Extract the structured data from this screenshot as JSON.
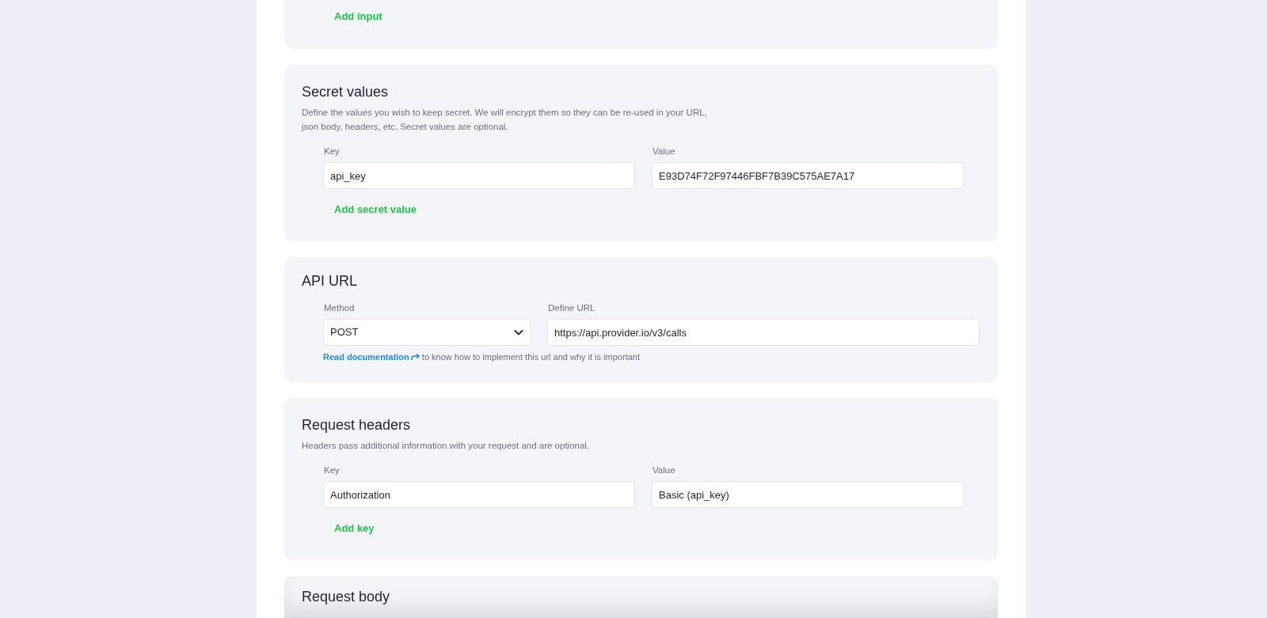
{
  "sections": [
    {
      "kind": "inputs",
      "add_link": "Add input"
    },
    {
      "kind": "key_value",
      "title": "Secret values",
      "description": "Define the values you wish to keep secret. We will encrypt them so they can be re-used in your URL, json body, headers, etc. Secret values are optional.",
      "pairs": [
        {
          "key_label": "Key",
          "key": "api_key",
          "value_label": "Value",
          "value": "E93D74F72F97446FBF7B39C575AE7A17"
        }
      ],
      "add_link": "Add secret value"
    },
    {
      "kind": "api_url",
      "title": "API URL",
      "method_label": "Method",
      "method": "POST",
      "url_label": "Define URL",
      "url": "https://api.provider.io/v3/calls",
      "doc_link": "Read documentation",
      "doc_text": "to know how to implement this url and why it is important"
    },
    {
      "kind": "key_value",
      "title": "Request headers",
      "description": "Headers pass additional information with your request and are optional.",
      "pairs": [
        {
          "key_label": "Key",
          "key": "Authorization",
          "value_label": "Value",
          "value": "Basic (api_key)"
        }
      ],
      "add_link": "Add key"
    },
    {
      "kind": "body",
      "title": "Request body"
    }
  ]
}
